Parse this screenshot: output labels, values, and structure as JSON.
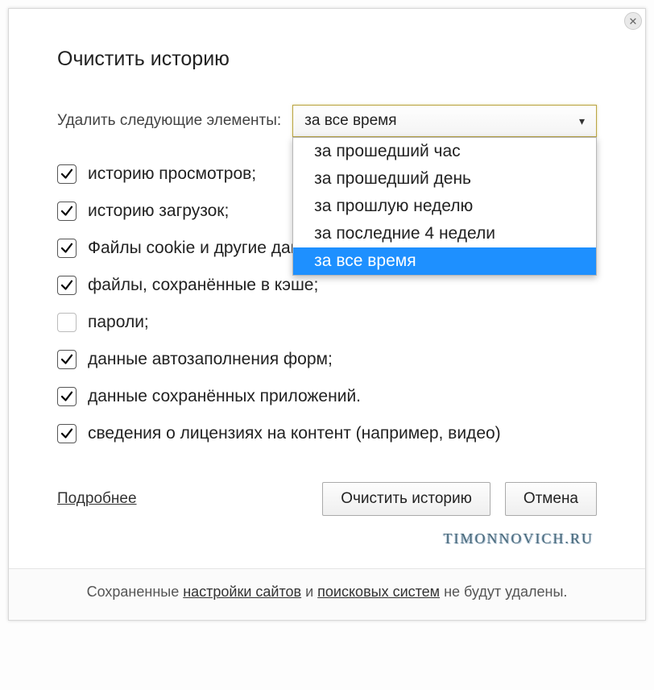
{
  "dialog": {
    "title": "Очистить историю",
    "close_label": "✕"
  },
  "range": {
    "label": "Удалить следующие элементы:",
    "selected": "за все время",
    "options": [
      "за прошедший час",
      "за прошедший день",
      "за прошлую неделю",
      "за последние 4 недели",
      "за все время"
    ]
  },
  "checks": [
    {
      "label": "историю просмотров;",
      "checked": true
    },
    {
      "label": "историю загрузок;",
      "checked": true
    },
    {
      "label": "Файлы cookie и другие данные сайтов и модулей",
      "checked": true
    },
    {
      "label": "файлы, сохранённые в кэше;",
      "checked": true
    },
    {
      "label": "пароли;",
      "checked": false
    },
    {
      "label": "данные автозаполнения форм;",
      "checked": true
    },
    {
      "label": "данные сохранённых приложений.",
      "checked": true
    },
    {
      "label": "сведения о лицензиях на контент (например, видео)",
      "checked": true
    }
  ],
  "buttons": {
    "more": "Подробнее",
    "clear": "Очистить историю",
    "cancel": "Отмена"
  },
  "watermark": "TIMONNOVICH.RU",
  "footer": {
    "pre": "Сохраненные ",
    "link1": "настройки сайтов",
    "mid": " и ",
    "link2": "поисковых систем",
    "post": " не будут удалены."
  }
}
